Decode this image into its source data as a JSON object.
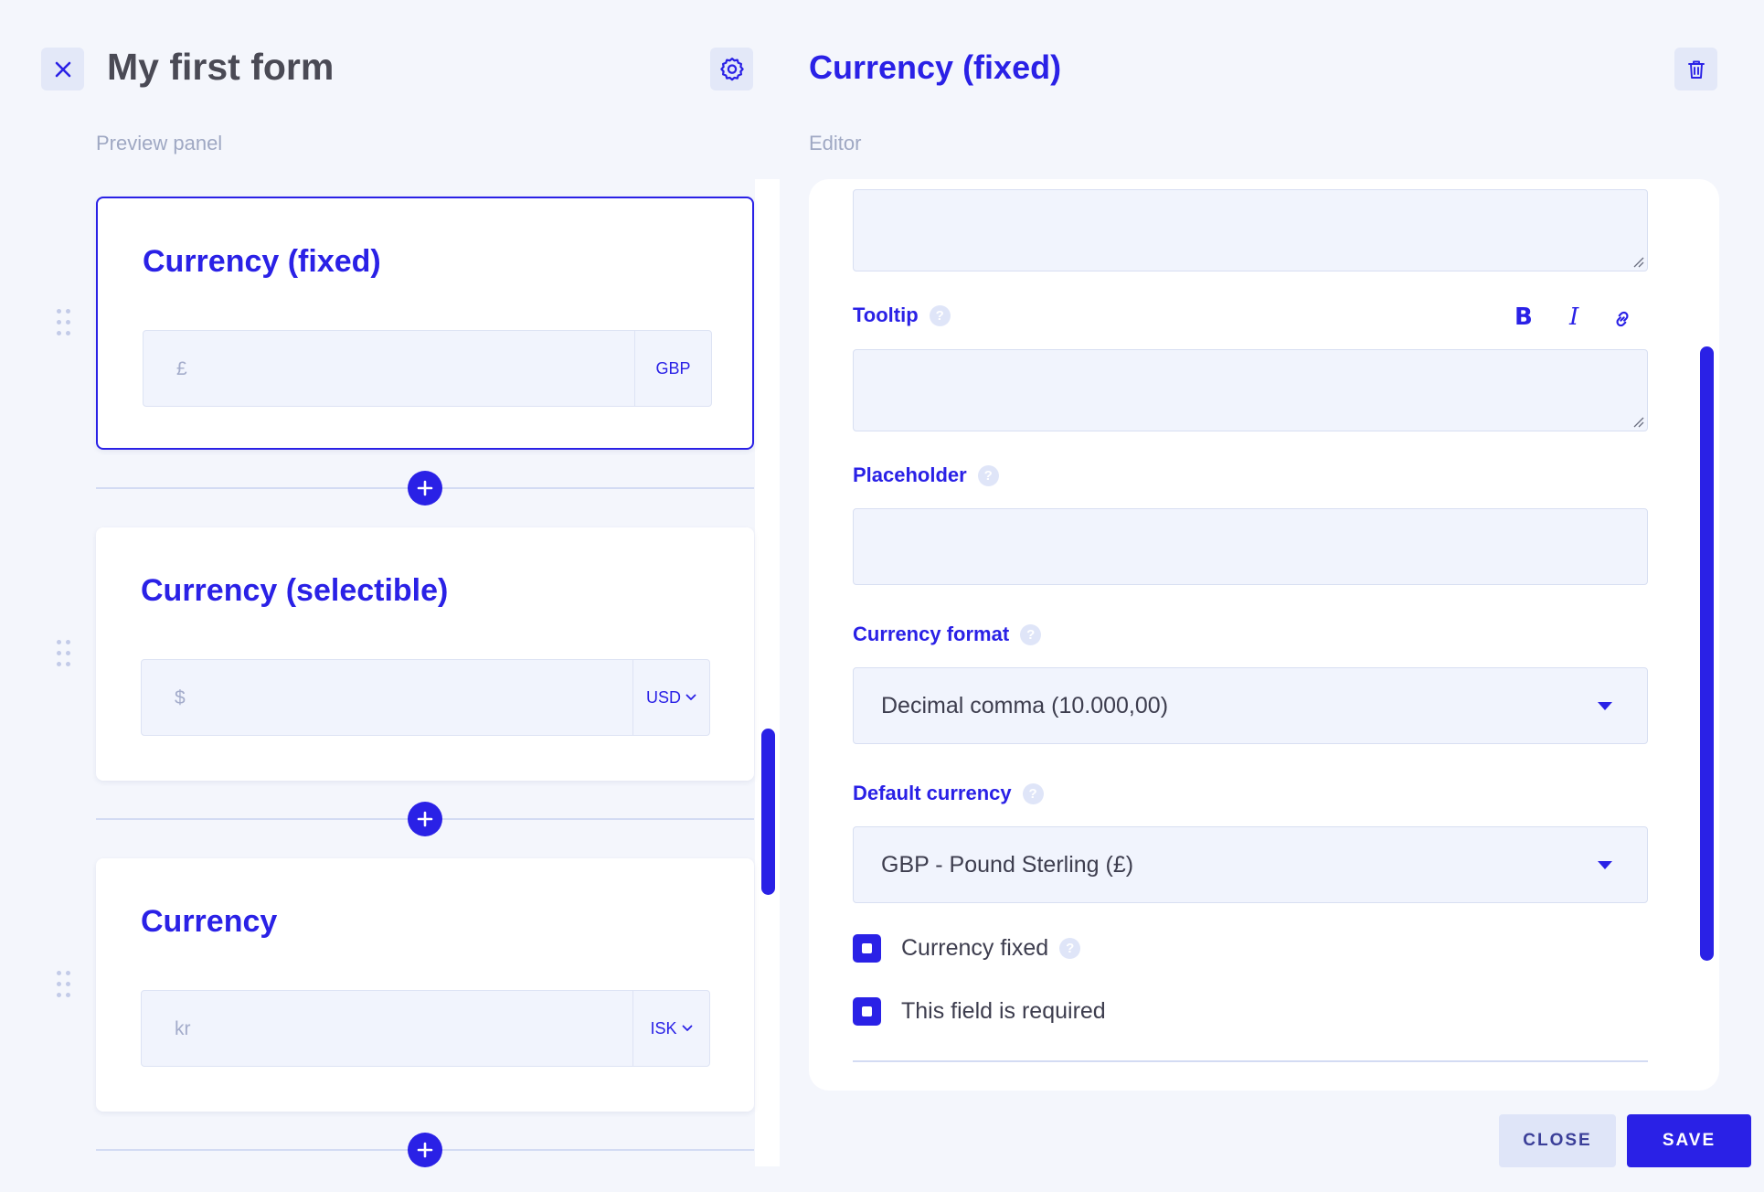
{
  "left": {
    "form_title": "My first form",
    "section_label": "Preview panel",
    "cards": [
      {
        "title": "Currency (fixed)",
        "symbol": "£",
        "code": "GBP",
        "has_dropdown": false
      },
      {
        "title": "Currency (selectible)",
        "symbol": "$",
        "code": "USD",
        "has_dropdown": true
      },
      {
        "title": "Currency",
        "symbol": "kr",
        "code": "ISK",
        "has_dropdown": true
      }
    ]
  },
  "editor": {
    "title": "Currency (fixed)",
    "section_label": "Editor",
    "tooltip_label": "Tooltip",
    "format_buttons": {
      "bold": "B",
      "italic": "I"
    },
    "placeholder_label": "Placeholder",
    "currency_format_label": "Currency format",
    "currency_format_value": "Decimal comma (10.000,00)",
    "default_currency_label": "Default currency",
    "default_currency_value": "GBP - Pound Sterling (£)",
    "currency_fixed_label": "Currency fixed",
    "required_label": "This field is required",
    "help_glyph": "?"
  },
  "footer": {
    "close_label": "CLOSE",
    "save_label": "SAVE"
  },
  "colors": {
    "accent": "#2a21e6",
    "background": "#f4f6fc",
    "input_bg": "#f1f4fd",
    "muted_label": "#9fa8c3"
  }
}
